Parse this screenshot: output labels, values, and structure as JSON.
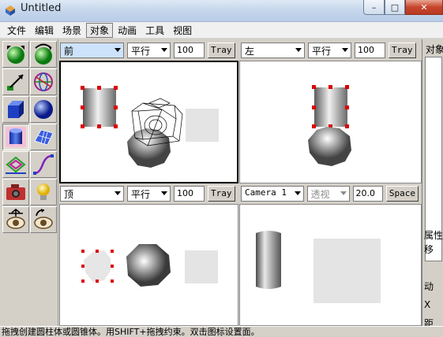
{
  "window": {
    "title": "Untitled",
    "minimize": "–",
    "maximize": "□",
    "close": "✕"
  },
  "menu": [
    "文件",
    "编辑",
    "场景",
    "对象",
    "动画",
    "工具",
    "视图"
  ],
  "menu_active_index": 3,
  "toolbox": {
    "icons": [
      "green-sphere-move-icon",
      "green-sphere-rotate-icon",
      "arrow-line-icon",
      "globe-grid-icon",
      "blue-cube-icon",
      "blue-sphere-icon",
      "blue-cylinder-icon",
      "blue-mesh-icon",
      "lathe-icon",
      "curve-icon",
      "camera-icon",
      "light-bulb-icon",
      "eye-move-icon",
      "eye-rotate-icon"
    ],
    "pressed_index": 6
  },
  "viewports": {
    "top_left": {
      "view": "前",
      "projection": "平行",
      "zoom": "100",
      "tray": "Tray"
    },
    "top_right": {
      "view": "左",
      "projection": "平行",
      "zoom": "100",
      "tray": "Tray"
    },
    "bottom_left": {
      "view": "顶",
      "projection": "平行",
      "zoom": "100",
      "tray": "Tray"
    },
    "bottom_right": {
      "camera": "Camera 1",
      "projection": "透视",
      "fov": "20.0",
      "space": "Space"
    }
  },
  "right_panel": {
    "title": "对象",
    "lower_labels": [
      "属性",
      "移",
      "动",
      "X",
      "距"
    ]
  },
  "status": "拖拽创建圆柱体或圆锥体。用SHIFT+拖拽约束。双击图标设置面。",
  "colors": {
    "selection_handle": "#dd0000",
    "viewport_bg": "#ffffff",
    "chrome": "#d4d0c8"
  }
}
